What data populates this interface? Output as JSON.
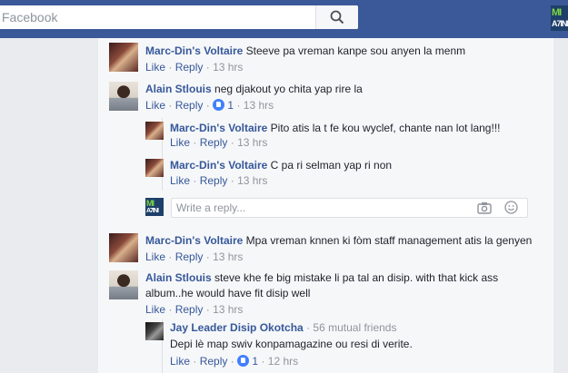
{
  "header": {
    "search_placeholder": "Facebook",
    "page_avatar_top": "MI",
    "page_avatar_bottom": "A7INI"
  },
  "actions": {
    "like": "Like",
    "reply": "Reply",
    "sep": "·"
  },
  "comments": [
    {
      "author": "Marc-Din's Voltaire",
      "text": "Steeve pa vreman kanpe sou anyen la menm",
      "time": "13 hrs"
    },
    {
      "author": "Alain Stlouis",
      "text": "neg djakout yo chita yap rire la",
      "time": "13 hrs",
      "likes": "1"
    },
    {
      "author": "Marc-Din's Voltaire",
      "text": "Pito atis la t fe kou wyclef, chante nan lot lang!!!",
      "time": "13 hrs"
    },
    {
      "author": "Marc-Din's Voltaire",
      "text": "C pa ri selman yap ri non",
      "time": "13 hrs"
    },
    {
      "author": "Marc-Din's Voltaire",
      "text": "Mpa vreman knnen ki fòm staff management atis la genyen",
      "time": "13 hrs"
    },
    {
      "author": "Alain Stlouis",
      "text_line1": "steve khe fe big mistake li pa tal an disip. with that kick ass",
      "text_line2": "album..he would have fit disip well",
      "time": "13 hrs"
    },
    {
      "author": "Jay Leader Disip Okotcha",
      "mutual": "56 mutual friends",
      "text": "Depi lè map swiv konpamagazine ou resi di verite.",
      "time": "12 hrs",
      "likes": "1"
    }
  ],
  "reply_box": {
    "placeholder": "Write a reply..."
  },
  "colors": {
    "topbar": "#3b5998",
    "link": "#365899",
    "meta": "#90949c",
    "like_badge": "#4080ff"
  }
}
